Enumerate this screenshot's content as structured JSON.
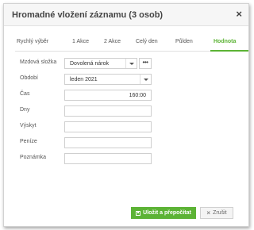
{
  "dialog": {
    "title": "Hromadné vložení záznamu (3 osob)",
    "close_symbol": "×"
  },
  "tabs": [
    {
      "label": "Rychlý výběr",
      "active": false
    },
    {
      "label": "1 Akce",
      "active": false
    },
    {
      "label": "2 Akce",
      "active": false
    },
    {
      "label": "Celý den",
      "active": false
    },
    {
      "label": "Půlden",
      "active": false
    },
    {
      "label": "Hodnota",
      "active": true
    }
  ],
  "form": {
    "mzdova_slozka": {
      "label": "Mzdová složka",
      "value": "Dovolená nárok",
      "more": "•••"
    },
    "obdobi": {
      "label": "Období",
      "value": "leden 2021"
    },
    "cas": {
      "label": "Čas",
      "value": "160:00"
    },
    "dny": {
      "label": "Dny",
      "value": ""
    },
    "vyskyt": {
      "label": "Výskyt",
      "value": ""
    },
    "penize": {
      "label": "Peníze",
      "value": ""
    },
    "poznamka": {
      "label": "Poznámka",
      "value": ""
    }
  },
  "buttons": {
    "save_label": "Uložit a přepočítat",
    "cancel_label": "Zrušit",
    "cancel_icon": "×"
  },
  "colors": {
    "accent": "#5cb335",
    "title_bar": "#f6f6f6"
  },
  "icons": {
    "save": "floppy-disk-icon",
    "cancel": "close-icon",
    "more": "ellipsis-icon",
    "dropdown": "chevron-down-icon"
  }
}
